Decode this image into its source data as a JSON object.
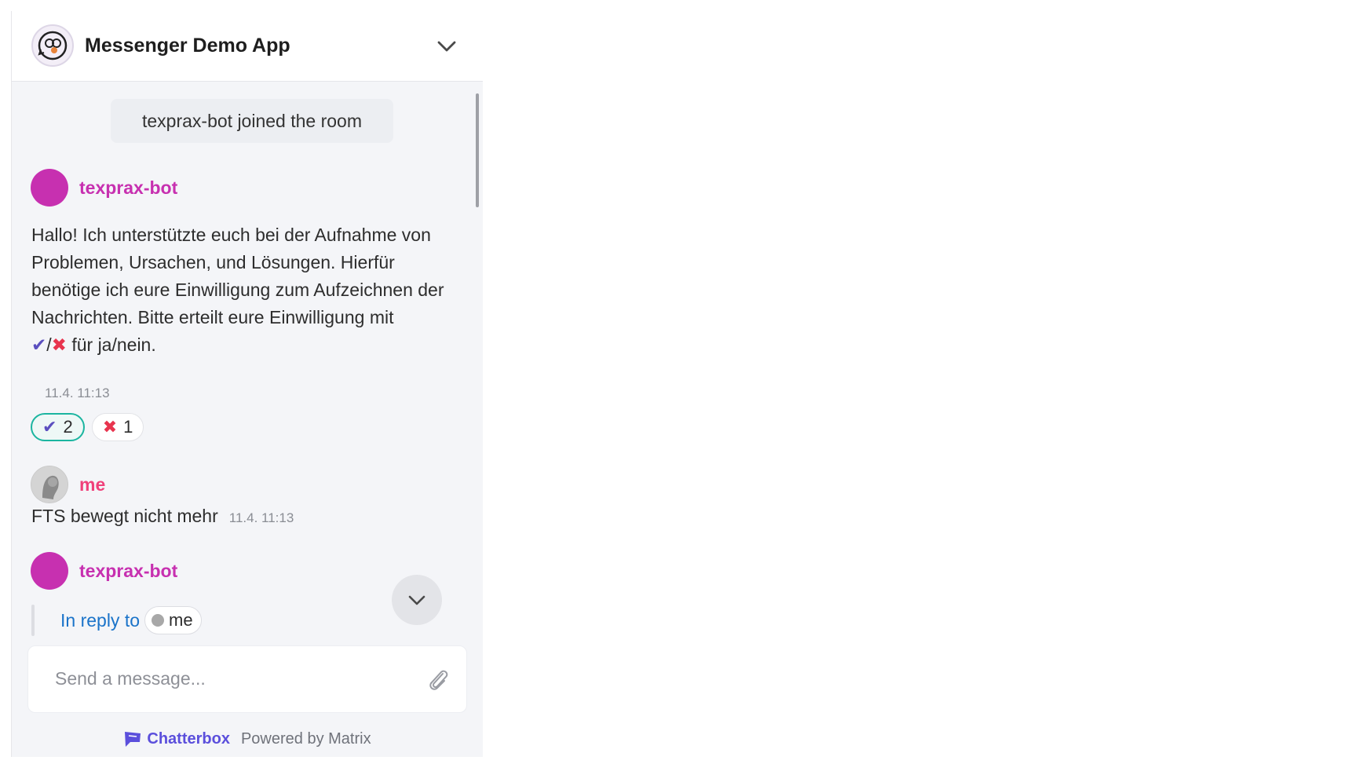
{
  "app": {
    "title": "Messenger Demo App"
  },
  "timeline": {
    "join_notice": "texprax-bot joined the room",
    "messages": [
      {
        "sender": "texprax-bot",
        "lines": [
          "Hallo! Ich unterstützte euch bei der Aufnahme von",
          "Problemen, Ursachen, und Lösungen. Hierfür",
          "benötige ich eure Einwilligung zum Aufzeichnen der",
          "Nachrichten. Bitte erteilt eure Einwilligung mit"
        ],
        "last_line_suffix": "für ja/nein.",
        "timestamp": "11.4. 11:13",
        "reactions": [
          {
            "emoji": "✔",
            "count": "2",
            "active": true
          },
          {
            "emoji": "✖",
            "count": "1",
            "active": false
          }
        ]
      },
      {
        "sender": "me",
        "text": "FTS bewegt nicht mehr",
        "timestamp": "11.4. 11:13"
      },
      {
        "sender": "texprax-bot",
        "reply_label": "In reply to",
        "reply_to": "me"
      }
    ]
  },
  "composer": {
    "placeholder": "Send a message..."
  },
  "footer": {
    "brand": "Chatterbox",
    "powered": "Powered by Matrix"
  },
  "colors": {
    "bot": "#c730b0",
    "me": "#f0407a",
    "brand": "#5b4fdc",
    "link": "#1a73c9"
  }
}
